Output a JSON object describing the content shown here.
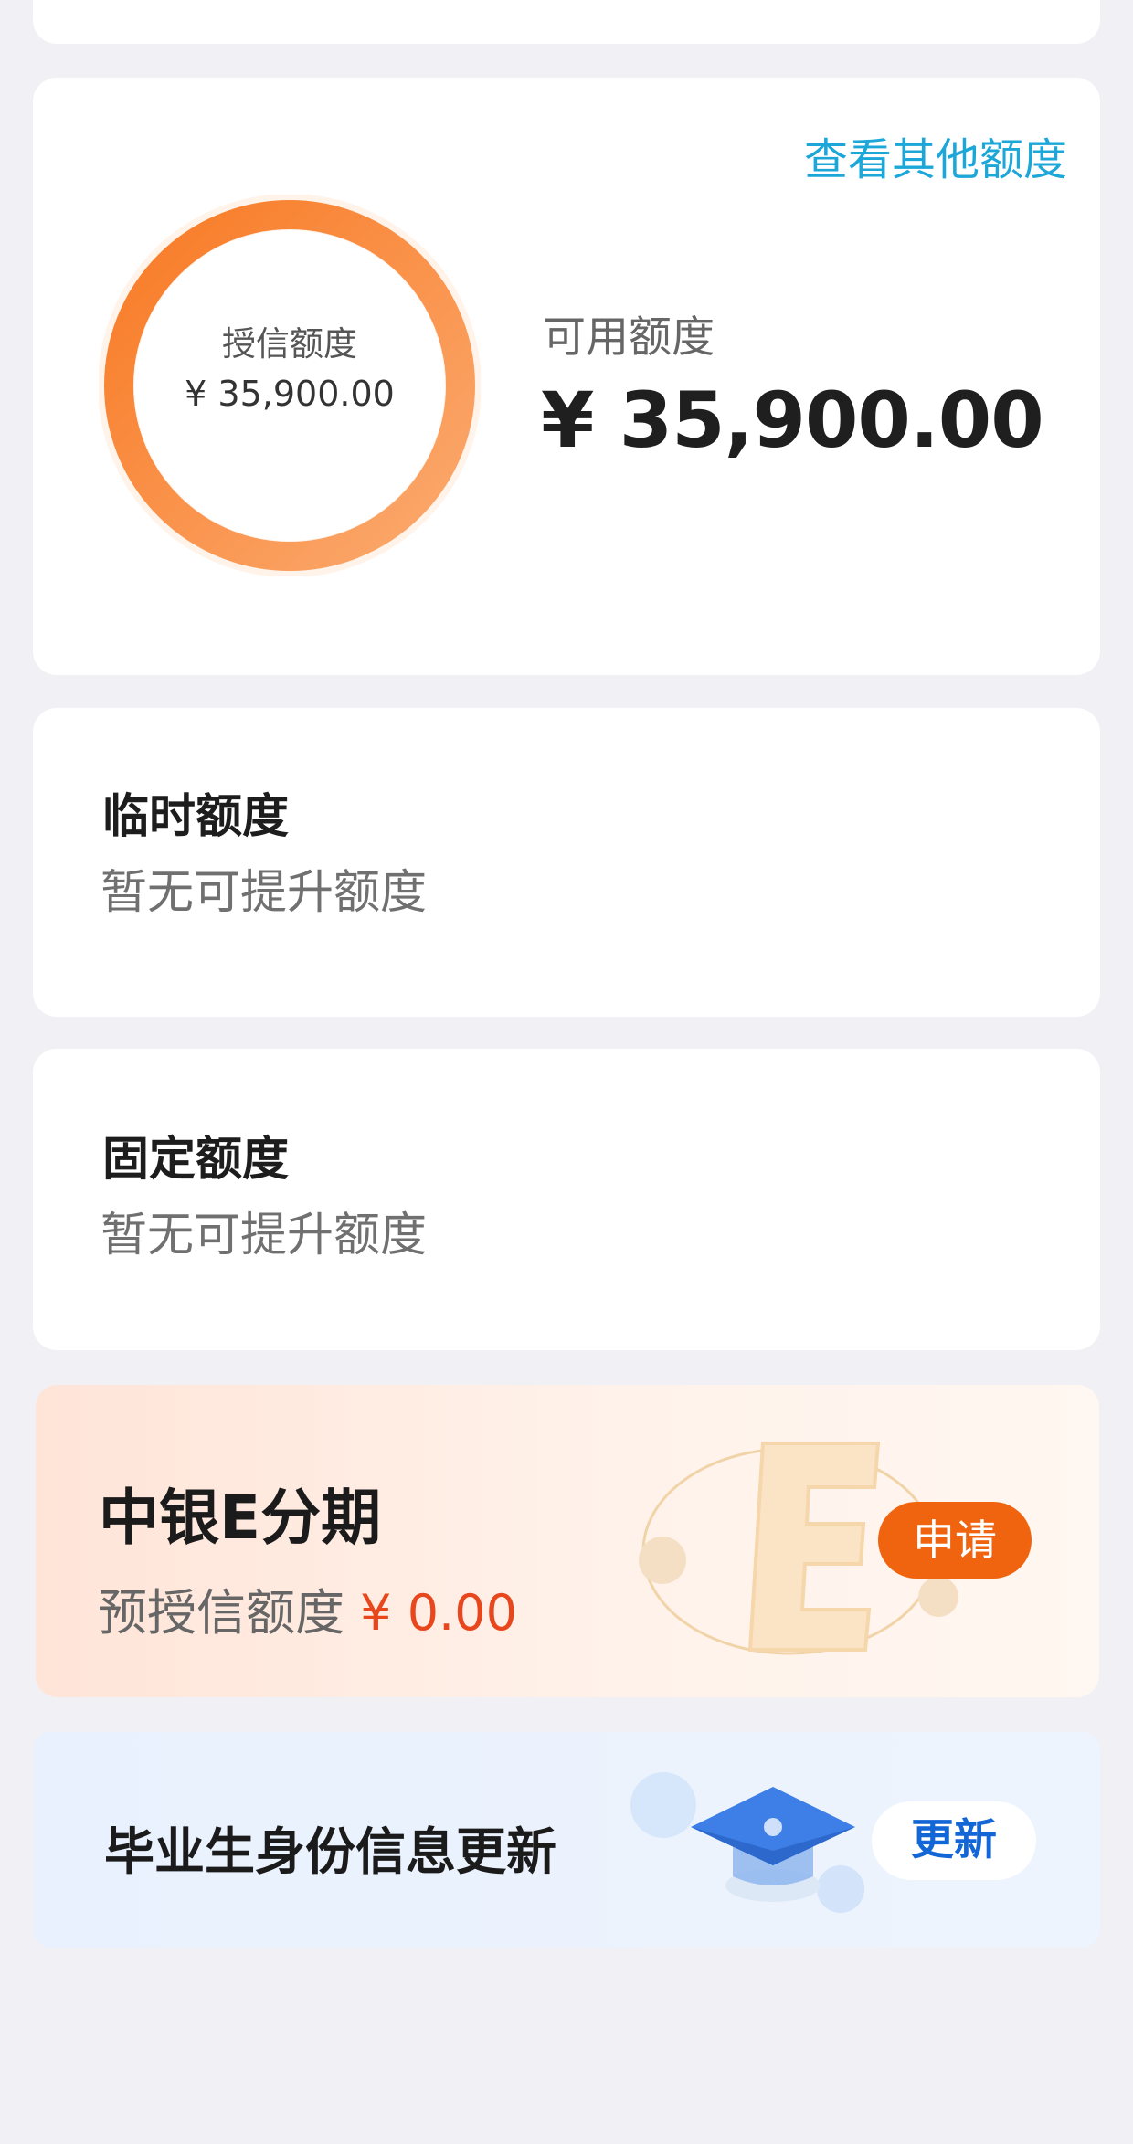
{
  "credit": {
    "other_link": "查看其他额度",
    "ring_title": "授信额度",
    "ring_amount": "¥ 35,900.00",
    "available_label": "可用额度",
    "available_amount": "¥ 35,900.00"
  },
  "temporary": {
    "title": "临时额度",
    "subtitle": "暂无可提升额度"
  },
  "fixed": {
    "title": "固定额度",
    "subtitle": "暂无可提升额度"
  },
  "installment": {
    "title": "中银E分期",
    "subtitle_label": "预授信额度",
    "subtitle_amount": "¥ 0.00",
    "button": "申请"
  },
  "graduate": {
    "title": "毕业生身份信息更新",
    "button": "更新"
  },
  "colors": {
    "accent_blue": "#1da7d8",
    "ring_orange": "#f7893d",
    "promo_orange": "#f0640f",
    "amount_red": "#e8461c",
    "update_blue": "#1266d6"
  },
  "icons": [
    "e-logo-icon",
    "graduation-cap-icon"
  ]
}
